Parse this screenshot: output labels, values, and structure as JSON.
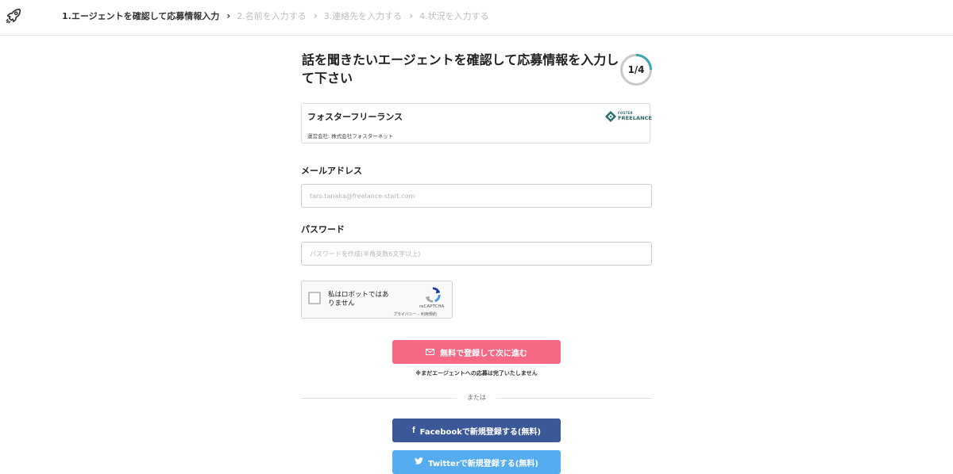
{
  "header": {
    "logo_icon": "rocket-icon",
    "steps": [
      {
        "label": "1.エージェントを確認して応募情報入力",
        "active": true
      },
      {
        "label": "2.名前を入力する",
        "active": false
      },
      {
        "label": "3.連絡先を入力する",
        "active": false
      },
      {
        "label": "4.状況を入力する",
        "active": false
      }
    ]
  },
  "main": {
    "title": "話を聞きたいエージェントを確認して応募情報を入力して下さい",
    "progress": {
      "label": "1/4",
      "fraction": 0.25,
      "color": "#3aa6b0"
    },
    "agent": {
      "name": "フォスターフリーランス",
      "company": "運営会社: 株式会社フォスターネット",
      "logo_text_top": "FOSTER",
      "logo_text_main": "FREELANCE"
    },
    "email": {
      "label": "メールアドレス",
      "placeholder": "taro.tanaka@freelance-start.com",
      "value": ""
    },
    "password": {
      "label": "パスワード",
      "placeholder": "パスワードを作成(半角英数6文字以上)",
      "value": ""
    },
    "recaptcha": {
      "label": "私はロボットではありません",
      "brand": "reCAPTCHA",
      "links": "プライバシー - 利用規約"
    },
    "submit": {
      "label": "無料で登録して次に進む",
      "icon": "mail-icon",
      "color": "#f56985"
    },
    "note": "※まだエージェントへの応募は完了いたしません",
    "divider": "または",
    "facebook": {
      "label": "Facebookで新規登録する(無料)",
      "icon": "facebook-icon",
      "color": "#3b5998"
    },
    "twitter": {
      "label": "Twitterで新規登録する(無料)",
      "icon": "twitter-icon",
      "color": "#55acee"
    }
  }
}
